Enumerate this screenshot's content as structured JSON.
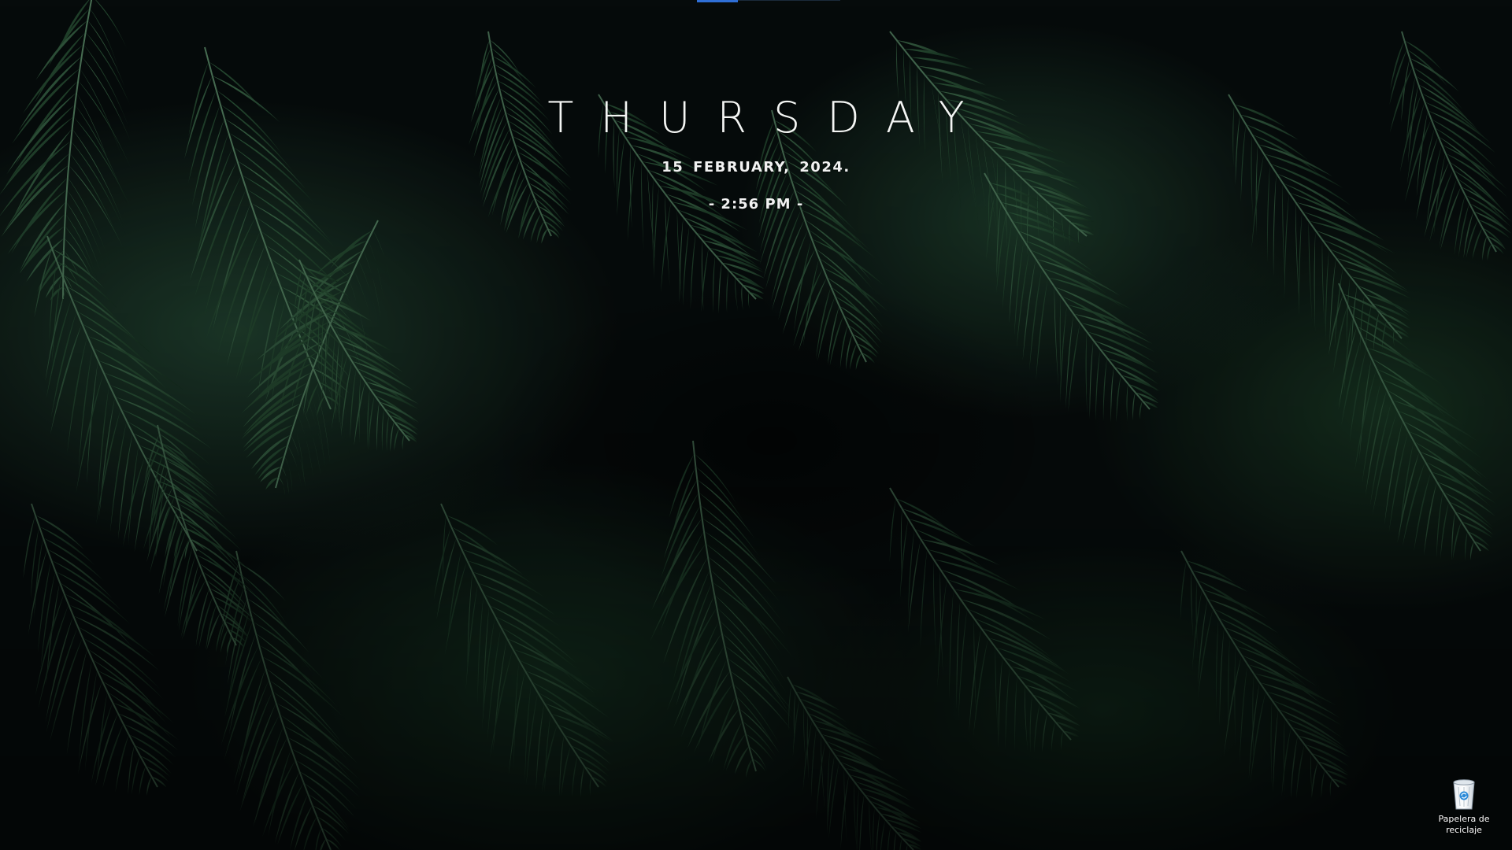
{
  "clock": {
    "day": "THURSDAY",
    "date": "15  FEBRUARY,  2024.",
    "time": "- 2:56 PM -"
  },
  "desktop_icons": [
    {
      "label": "Papelera de reciclaje",
      "icon": "recycle-bin-icon"
    }
  ],
  "colors": {
    "accent": "#2f6fd6",
    "clock_text": "#ffffff",
    "foliage": "#2a4a33"
  }
}
